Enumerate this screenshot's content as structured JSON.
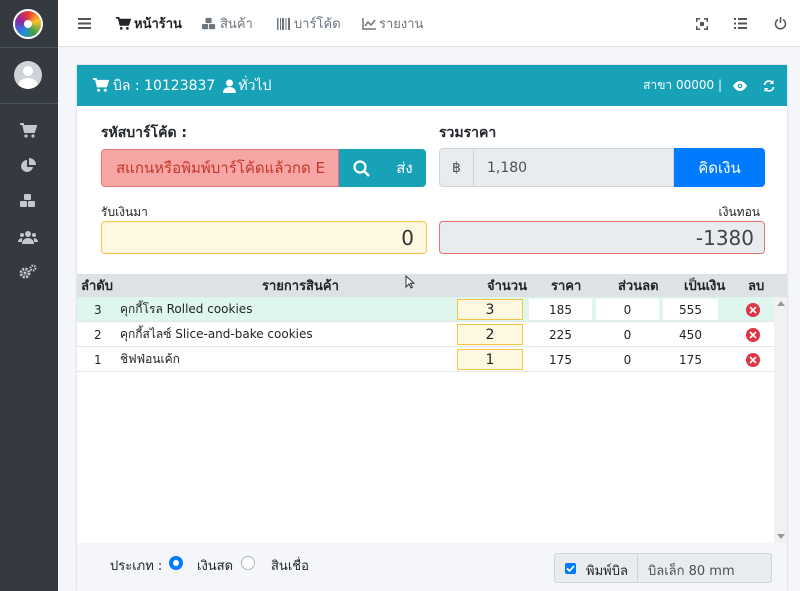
{
  "navbar": {
    "items": [
      {
        "label": "หน้าร้าน",
        "icon": "cart-icon"
      },
      {
        "label": "สินค้า",
        "icon": "cubes-icon"
      },
      {
        "label": "บาร์โค้ด",
        "icon": "barcode-icon"
      },
      {
        "label": "รายงาน",
        "icon": "line-chart-icon"
      }
    ]
  },
  "bill": {
    "bill_label": "บิล : 10123837",
    "customer": "ทั่วไป",
    "branch": "สาขา 00000 |"
  },
  "form": {
    "barcode_label": "รหัสบาร์โค้ด :",
    "barcode_placeholder": "สแกนหรือพิมพ์บาร์โค้ดแล้วกด E",
    "send_label": "ส่ง",
    "total_label": "รวมราคา",
    "currency": "฿",
    "total_value": "1,180",
    "pay_label": "คิดเงิน",
    "received_label": "รับเงินมา",
    "received_value": "0",
    "change_label": "เงินทอน",
    "change_value": "-1380"
  },
  "table": {
    "headers": [
      "ลำดับ",
      "รายการสินค้า",
      "จำนวน",
      "ราคา",
      "ส่วนลด",
      "เป็นเงิน",
      "ลบ"
    ],
    "rows": [
      {
        "no": "3",
        "name": "คุกกี้โรล Rolled cookies",
        "qty": "3",
        "price": "185",
        "discount": "0",
        "amount": "555"
      },
      {
        "no": "2",
        "name": "คุกกี้สไลซ์ Slice-and-bake cookies",
        "qty": "2",
        "price": "225",
        "discount": "0",
        "amount": "450"
      },
      {
        "no": "1",
        "name": "ชิฟฟ่อนเค้ก",
        "qty": "1",
        "price": "175",
        "discount": "0",
        "amount": "175"
      }
    ]
  },
  "footer": {
    "type_label": "ประเภท :",
    "cash_label": "เงินสด",
    "credit_label": "สินเชื่อ",
    "print_label": "พิมพ์บิล",
    "paper_size": "บิลเล็ก 80 mm"
  },
  "colors": {
    "sidebar": "#343a40",
    "header": "#17a2b8",
    "primary": "#007bff",
    "danger": "#dc3545"
  }
}
